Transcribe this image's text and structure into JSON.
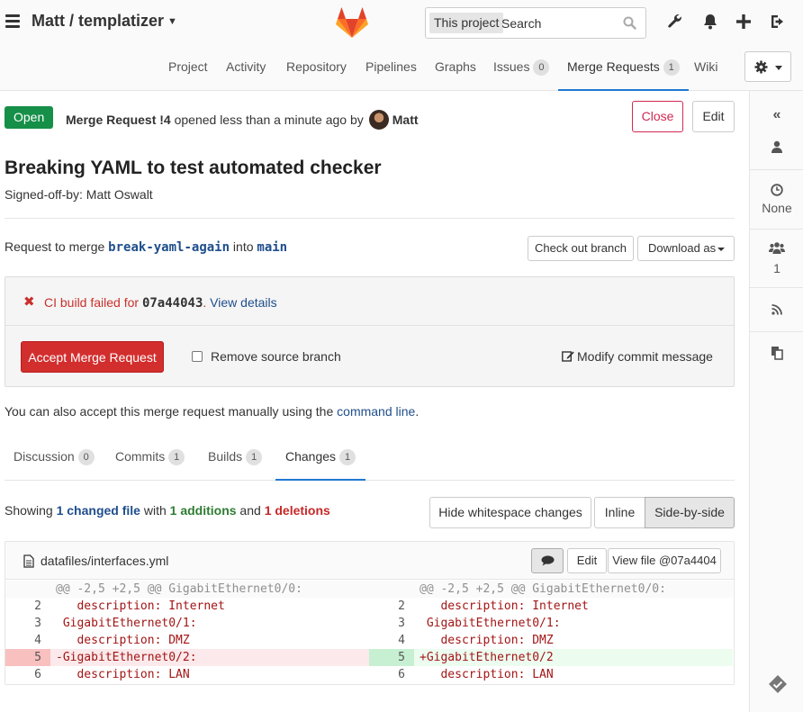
{
  "header": {
    "project_title": "Matt / templatizer",
    "search": {
      "scope": "This project",
      "placeholder": "Search"
    },
    "nav_tabs": [
      {
        "label": "Project"
      },
      {
        "label": "Activity"
      },
      {
        "label": "Repository"
      },
      {
        "label": "Pipelines"
      },
      {
        "label": "Graphs"
      },
      {
        "label": "Issues",
        "count": "0"
      },
      {
        "label": "Merge Requests",
        "count": "1"
      },
      {
        "label": "Wiki"
      }
    ]
  },
  "sidebar": {
    "milestone": "None",
    "participants_count": "1"
  },
  "mr": {
    "status": "Open",
    "ref": "Merge Request !4",
    "opened_text": " opened less than a minute ago by",
    "author": "Matt",
    "close_label": "Close",
    "edit_label": "Edit",
    "title": "Breaking YAML to test automated checker",
    "description": "Signed-off-by: Matt Oswalt",
    "merge_prefix": "Request to merge ",
    "source_branch": "break-yaml-again",
    "merge_into": " into ",
    "target_branch": "main",
    "checkout_label": "Check out branch",
    "download_label": "Download as"
  },
  "ci": {
    "prefix": "CI build failed for ",
    "sha": "07a44043",
    "suffix": ". ",
    "link": "View details",
    "accept_label": "Accept Merge Request",
    "remove_branch_label": "Remove source branch",
    "modify_label": "Modify commit message"
  },
  "manual_note": {
    "prefix": "You can also accept this merge request manually using the ",
    "link": "command line",
    "suffix": "."
  },
  "mr_tabs": [
    {
      "label": "Discussion",
      "count": "0"
    },
    {
      "label": "Commits",
      "count": "1"
    },
    {
      "label": "Builds",
      "count": "1"
    },
    {
      "label": "Changes",
      "count": "1"
    }
  ],
  "diff": {
    "summary_prefix": "Showing ",
    "changed_files": "1 changed file",
    "summary_with": " with ",
    "additions": "1 additions",
    "summary_and": " and ",
    "deletions": "1 deletions",
    "hide_ws_label": "Hide whitespace changes",
    "inline_label": "Inline",
    "sbs_label": "Side-by-side",
    "file_name": "datafiles/interfaces.yml",
    "edit_label": "Edit",
    "view_file_label": "View file @07a4404",
    "hunk_header": "@@ -2,5 +2,5 @@ GigabitEthernet0/0:",
    "rows": [
      {
        "old_num": "2",
        "old": "   description: Internet",
        "new_num": "2",
        "new": "   description: Internet",
        "kind": "same"
      },
      {
        "old_num": "3",
        "old": " GigabitEthernet0/1:",
        "new_num": "3",
        "new": " GigabitEthernet0/1:",
        "kind": "same"
      },
      {
        "old_num": "4",
        "old": "   description: DMZ",
        "new_num": "4",
        "new": "   description: DMZ",
        "kind": "same"
      },
      {
        "old_num": "5",
        "old": "-GigabitEthernet0/2:",
        "new_num": "5",
        "new": "+GigabitEthernet0/2",
        "kind": "change"
      },
      {
        "old_num": "6",
        "old": "   description: LAN",
        "new_num": "6",
        "new": "   description: LAN",
        "kind": "same"
      }
    ]
  }
}
